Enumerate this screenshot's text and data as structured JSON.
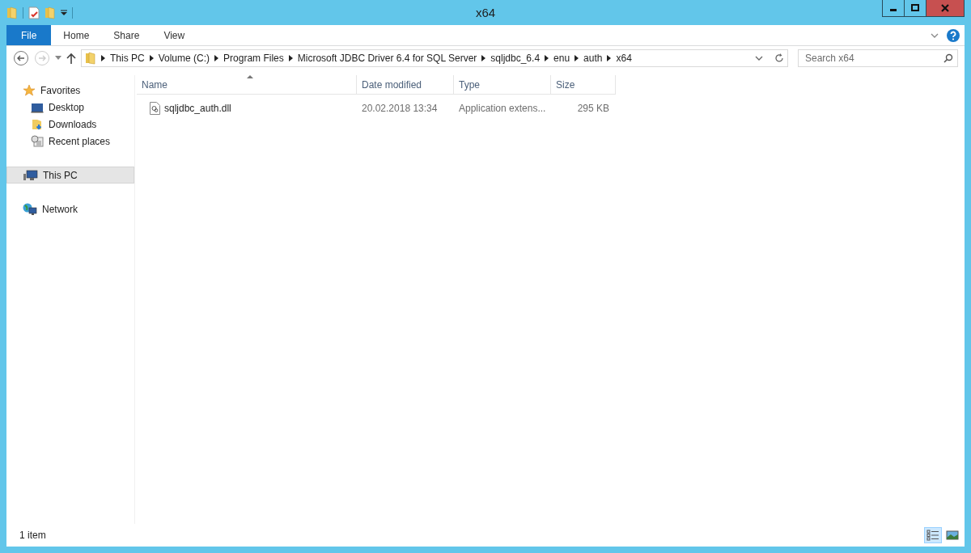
{
  "window": {
    "title": "x64"
  },
  "ribbon_tabs": [
    {
      "label": "File",
      "kind": "file",
      "selected": false
    },
    {
      "label": "Home",
      "kind": "tab",
      "selected": false
    },
    {
      "label": "Share",
      "kind": "tab",
      "selected": false
    },
    {
      "label": "View",
      "kind": "tab",
      "selected": false
    }
  ],
  "address_bar": {
    "breadcrumbs": [
      "This PC",
      "Volume (C:)",
      "Program Files",
      "Microsoft JDBC Driver 6.4 for SQL Server",
      "sqljdbc_6.4",
      "enu",
      "auth",
      "x64"
    ]
  },
  "search": {
    "placeholder": "Search x64"
  },
  "navigation": [
    {
      "label": "Favorites",
      "kind": "favorites",
      "selected": false,
      "children": [
        {
          "label": "Desktop",
          "kind": "desktop",
          "selected": false
        },
        {
          "label": "Downloads",
          "kind": "downloads",
          "selected": false
        },
        {
          "label": "Recent places",
          "kind": "recent",
          "selected": false
        }
      ]
    },
    {
      "label": "This PC",
      "kind": "pc",
      "selected": true
    },
    {
      "label": "Network",
      "kind": "network",
      "selected": false
    }
  ],
  "columns": [
    {
      "label": "Name",
      "sorted": true
    },
    {
      "label": "Date modified",
      "sorted": false
    },
    {
      "label": "Type",
      "sorted": false
    },
    {
      "label": "Size",
      "sorted": false
    }
  ],
  "rows": [
    {
      "name": "sqljdbc_auth.dll",
      "date_modified": "20.02.2018 13:34",
      "type": "Application extens...",
      "size": "295 KB"
    }
  ],
  "status_bar": {
    "item_count": "1 item"
  },
  "view_buttons": [
    {
      "kind": "details",
      "selected": true
    },
    {
      "kind": "large-icons",
      "selected": false
    }
  ]
}
